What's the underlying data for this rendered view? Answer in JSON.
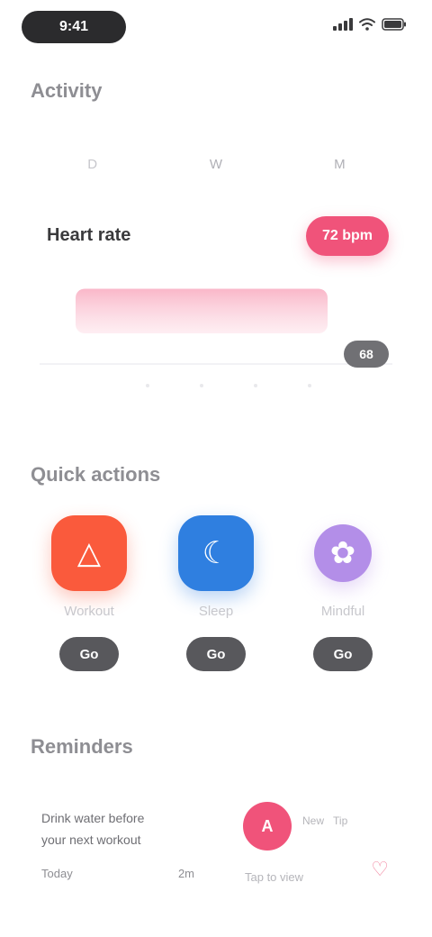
{
  "status_bar": {
    "time": "9:41"
  },
  "summary": {
    "title": "Activity",
    "tabs": [
      {
        "label": "D"
      },
      {
        "label": "W"
      },
      {
        "label": "M"
      }
    ],
    "trend": {
      "label": "Heart rate",
      "badge": "72 bpm",
      "current": "68",
      "level": 0.55
    }
  },
  "actions": {
    "title": "Quick actions",
    "items": [
      {
        "label": "Workout",
        "value": "Go",
        "icon": "flame-icon",
        "color": "#fa5a3c"
      },
      {
        "label": "Sleep",
        "value": "Go",
        "icon": "moon-icon",
        "color": "#2f7fe0"
      },
      {
        "label": "Mindful",
        "value": "Go",
        "icon": "leaf-icon",
        "color": "#b38ee8"
      }
    ]
  },
  "notices": {
    "title": "Reminders",
    "text_lines": [
      "Drink water before",
      "your next workout"
    ],
    "meta_left": "Today",
    "meta_right": "2m",
    "avatar_initial": "A",
    "tags": [
      "New",
      "Tip"
    ],
    "sub": "Tap to view",
    "accent": "#f0537a"
  }
}
